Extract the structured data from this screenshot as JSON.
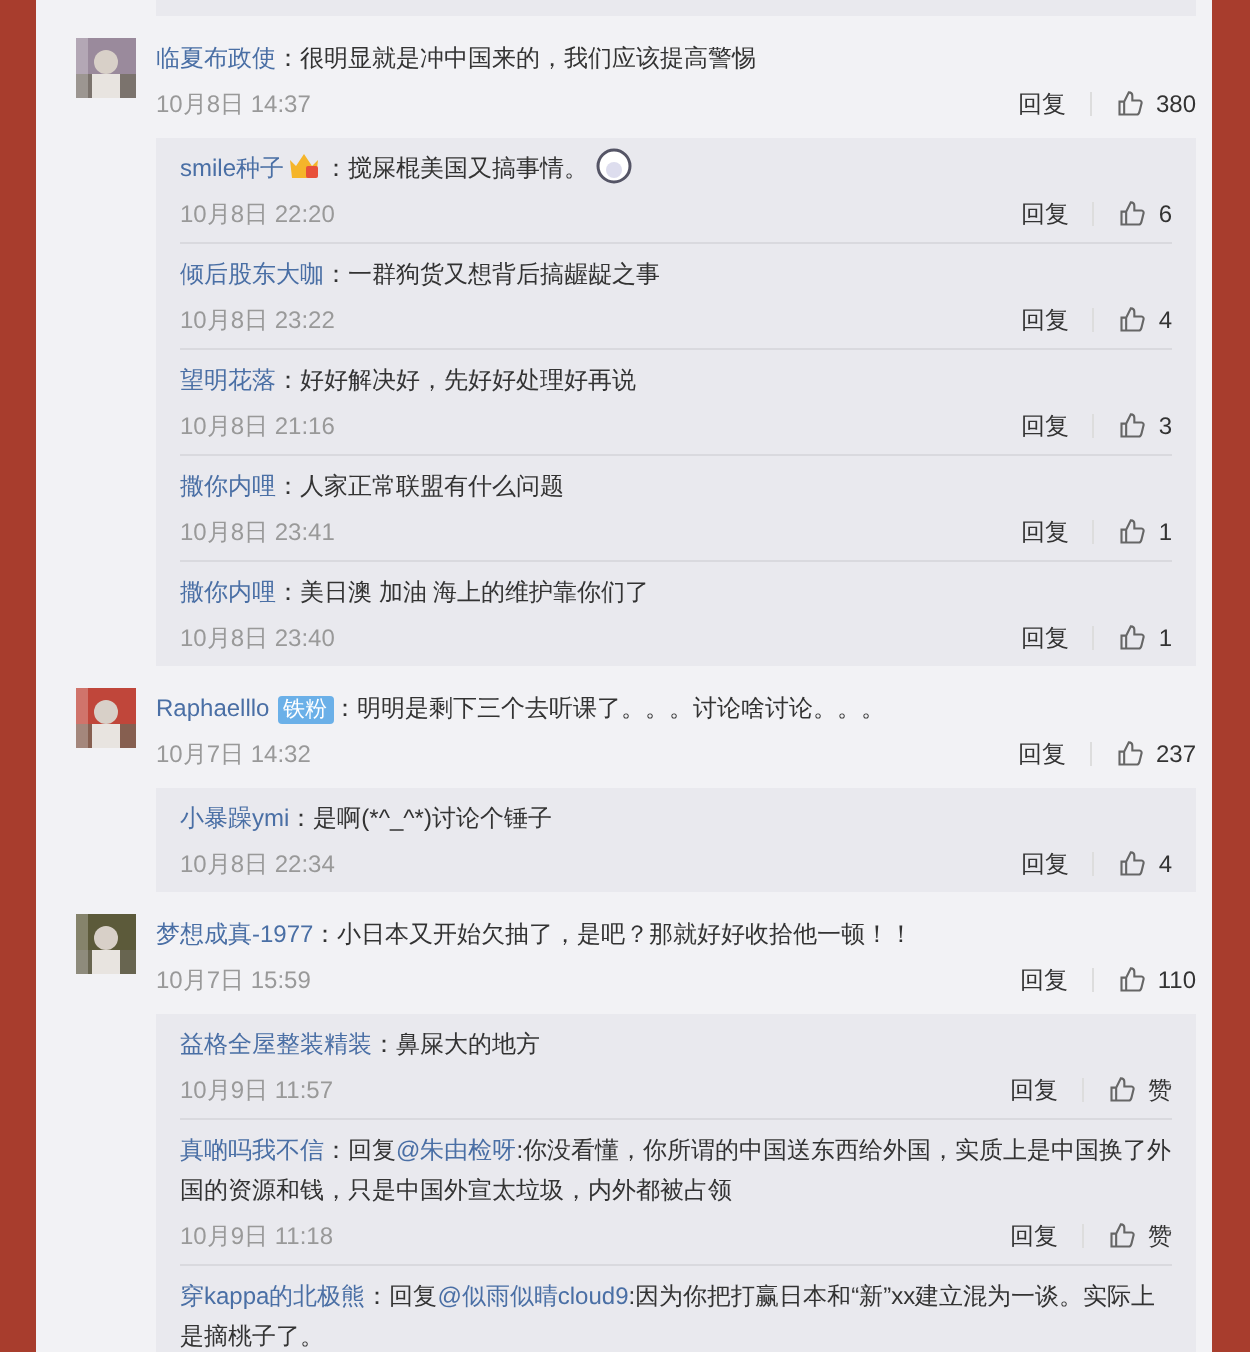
{
  "comments": [
    {
      "user": "临夏布政使",
      "parts": [
        {
          "kind": "plain",
          "text": "：很明显就是冲中国来的，我们应该提高警惕"
        }
      ],
      "time": "10月8日 14:37",
      "reply_label": "回复",
      "likes": "380",
      "replies": [
        {
          "user": "smile种子",
          "badge_icon": true,
          "parts": [
            {
              "kind": "plain",
              "text": "：搅屎棍美国又搞事情。"
            }
          ],
          "emoji": true,
          "time": "10月8日 22:20",
          "reply_label": "回复",
          "likes": "6"
        },
        {
          "user": "倾后股东大咖",
          "parts": [
            {
              "kind": "plain",
              "text": "：一群狗货又想背后搞龌龊之事"
            }
          ],
          "time": "10月8日 23:22",
          "reply_label": "回复",
          "likes": "4"
        },
        {
          "user": "望明花落",
          "parts": [
            {
              "kind": "plain",
              "text": "：好好解决好，先好好处理好再说"
            }
          ],
          "time": "10月8日 21:16",
          "reply_label": "回复",
          "likes": "3"
        },
        {
          "user": "撒你内哩",
          "parts": [
            {
              "kind": "plain",
              "text": "：人家正常联盟有什么问题"
            }
          ],
          "time": "10月8日 23:41",
          "reply_label": "回复",
          "likes": "1"
        },
        {
          "user": "撒你内哩",
          "parts": [
            {
              "kind": "plain",
              "text": "：美日澳 加油 海上的维护靠你们了"
            }
          ],
          "time": "10月8日 23:40",
          "reply_label": "回复",
          "likes": "1"
        }
      ]
    },
    {
      "user": "Raphaelllo",
      "fan_badge": "铁粉",
      "parts": [
        {
          "kind": "plain",
          "text": "：明明是剩下三个去听课了。。。讨论啥讨论。。。"
        }
      ],
      "time": "10月7日 14:32",
      "reply_label": "回复",
      "likes": "237",
      "replies": [
        {
          "user": "小暴躁ymi",
          "parts": [
            {
              "kind": "plain",
              "text": "：是啊(*^_^*)讨论个锤子"
            }
          ],
          "time": "10月8日 22:34",
          "reply_label": "回复",
          "likes": "4"
        }
      ]
    },
    {
      "user": "梦想成真-1977",
      "parts": [
        {
          "kind": "plain",
          "text": "：小日本又开始欠抽了，是吧？那就好好收拾他一顿！！"
        }
      ],
      "time": "10月7日 15:59",
      "reply_label": "回复",
      "likes": "110",
      "replies": [
        {
          "user": "益格全屋整装精装",
          "parts": [
            {
              "kind": "plain",
              "text": "：鼻屎大的地方"
            }
          ],
          "time": "10月9日 11:57",
          "reply_label": "回复",
          "likes": "赞"
        },
        {
          "user": "真啲吗我不信",
          "parts": [
            {
              "kind": "plain",
              "text": "：回复"
            },
            {
              "kind": "mention",
              "text": "@朱由检呀"
            },
            {
              "kind": "plain",
              "text": ":你没看懂，你所谓的中国送东西给外国，实质上是中国换了外国的资源和钱，只是中国外宣太垃圾，内外都被占领"
            }
          ],
          "time": "10月9日 11:18",
          "reply_label": "回复",
          "likes": "赞"
        },
        {
          "user": "穿kappa的北极熊",
          "parts": [
            {
              "kind": "plain",
              "text": "：回复"
            },
            {
              "kind": "mention",
              "text": "@似雨似晴cloud9"
            },
            {
              "kind": "plain",
              "text": ":因为你把打赢日本和“新”xx建立混为一谈。实际上是摘桃子了。"
            }
          ]
        }
      ]
    }
  ]
}
